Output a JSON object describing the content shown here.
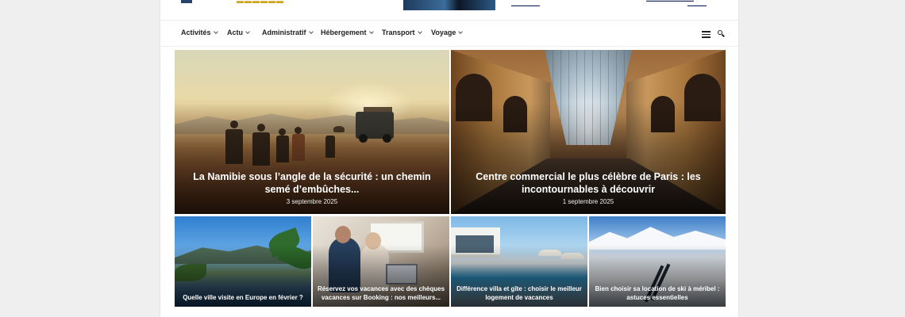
{
  "nav": {
    "items": [
      {
        "label": "Activités"
      },
      {
        "label": "Actu"
      },
      {
        "label": "Administratif"
      },
      {
        "label": "Hébergement"
      },
      {
        "label": "Transport"
      },
      {
        "label": "Voyage"
      }
    ],
    "icons": [
      "menu-icon",
      "search-icon"
    ]
  },
  "featured": [
    {
      "title": "La Namibie sous l’angle de la sécurité : un chemin semé d’embûches...",
      "date": "3 septembre 2025"
    },
    {
      "title": "Centre commercial le plus célèbre de Paris : les incontournables à découvrir",
      "date": "1 septembre 2025"
    }
  ],
  "secondary": [
    {
      "title": "Quelle ville visite en Europe en février ?"
    },
    {
      "title": "Réservez vos vacances avec des chèques vacances sur Booking : nos meilleurs..."
    },
    {
      "title": "Différence villa et gîte : choisir le meilleur logement de vacances"
    },
    {
      "title": "Bien choisir sa location de ski à méribel : astuces essentielles"
    }
  ],
  "colors": {
    "page_bg": "#efefef",
    "content_bg": "#ffffff",
    "nav_text": "#222222",
    "card_text": "#ffffff"
  }
}
